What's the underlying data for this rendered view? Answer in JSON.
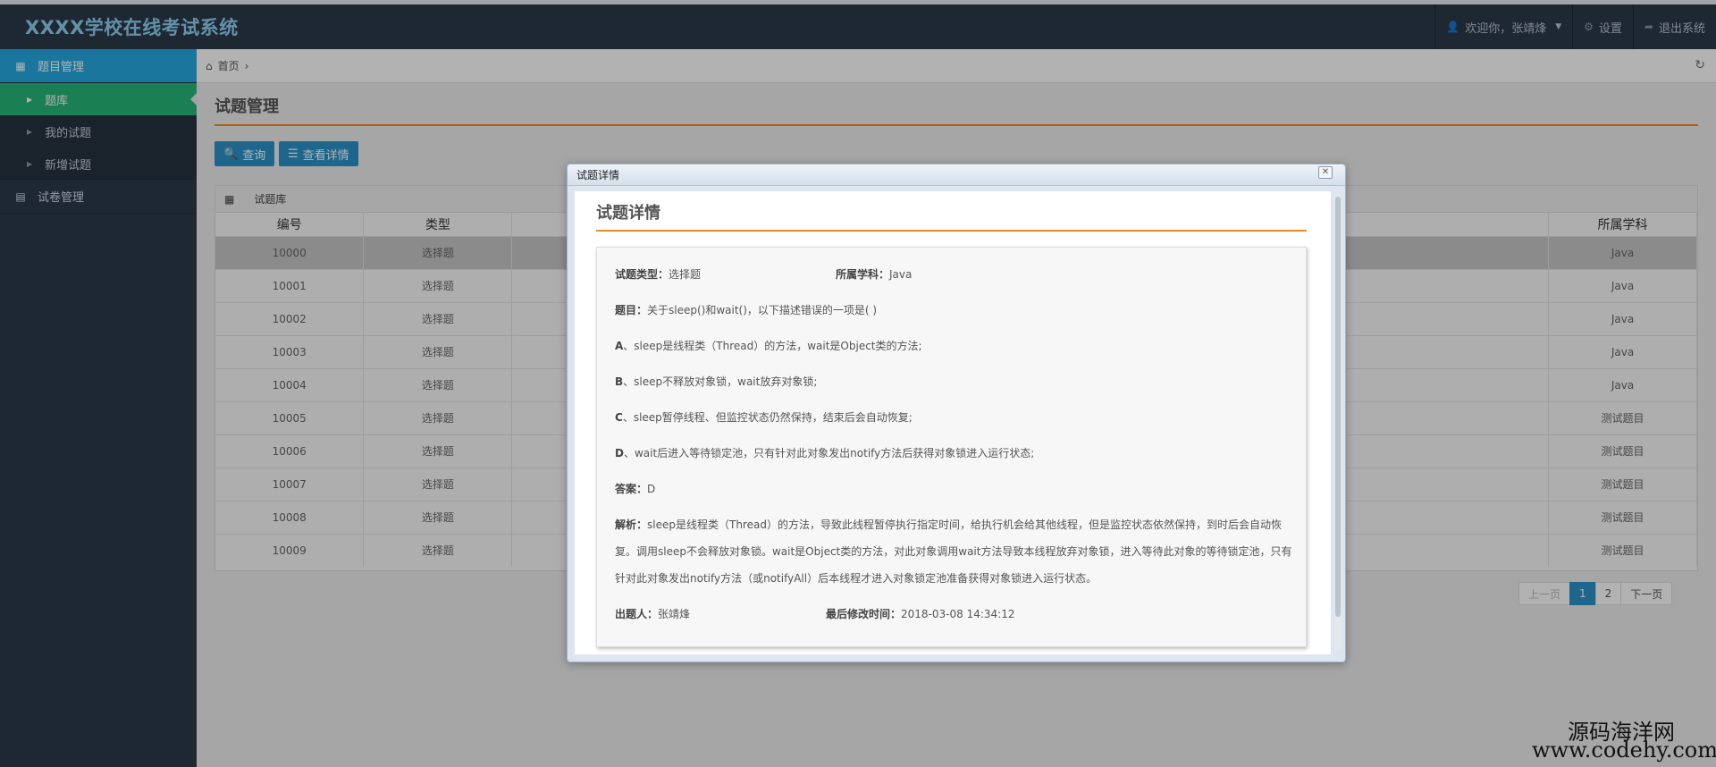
{
  "header": {
    "brand": "XXXX学校在线考试系统",
    "welcome": "欢迎你，张靖烽",
    "settings": "设置",
    "logout": "退出系统"
  },
  "sidebar": {
    "group1": "题目管理",
    "sub": [
      "题库",
      "我的试题",
      "新增试题"
    ],
    "group2": "试卷管理"
  },
  "breadcrumb": {
    "home": "首页"
  },
  "page": {
    "title": "试题管理",
    "query_btn": "查询",
    "detail_btn": "查看详情",
    "table_caption": "试题库"
  },
  "table": {
    "col_id": "编号",
    "col_type": "类型",
    "col_subject": "所属学科",
    "rows": [
      {
        "id": "10000",
        "type": "选择题",
        "subject": "Java"
      },
      {
        "id": "10001",
        "type": "选择题",
        "subject": "Java"
      },
      {
        "id": "10002",
        "type": "选择题",
        "subject": "Java"
      },
      {
        "id": "10003",
        "type": "选择题",
        "subject": "Java"
      },
      {
        "id": "10004",
        "type": "选择题",
        "subject": "Java"
      },
      {
        "id": "10005",
        "type": "选择题",
        "subject": "测试题目"
      },
      {
        "id": "10006",
        "type": "选择题",
        "subject": "测试题目"
      },
      {
        "id": "10007",
        "type": "选择题",
        "subject": "测试题目"
      },
      {
        "id": "10008",
        "type": "选择题",
        "subject": "测试题目"
      },
      {
        "id": "10009",
        "type": "选择题",
        "subject": "测试题目"
      }
    ]
  },
  "pager": {
    "prev": "上一页",
    "p1": "1",
    "p2": "2",
    "next": "下一页"
  },
  "modal": {
    "window_title": "试题详情",
    "heading": "试题详情",
    "type_label": "试题类型：",
    "type_value": "选择题",
    "subject_label": "所属学科：",
    "subject_value": "Java",
    "question_label": "题目：",
    "question_value": "关于sleep()和wait()，以下描述错误的一项是( )",
    "a_label": "A",
    "a_value": "、sleep是线程类（Thread）的方法，wait是Object类的方法;",
    "b_label": "B",
    "b_value": "、sleep不释放对象锁，wait放弃对象锁;",
    "c_label": "C",
    "c_value": "、sleep暂停线程、但监控状态仍然保持，结束后会自动恢复;",
    "d_label": "D",
    "d_value": "、wait后进入等待锁定池，只有针对此对象发出notify方法后获得对象锁进入运行状态;",
    "answer_label": "答案：",
    "answer_value": "D",
    "analysis_label": "解析：",
    "analysis_value": "sleep是线程类（Thread）的方法，导致此线程暂停执行指定时间，给执行机会给其他线程，但是监控状态依然保持，到时后会自动恢复。调用sleep不会释放对象锁。wait是Object类的方法，对此对象调用wait方法导致本线程放弃对象锁，进入等待此对象的等待锁定池，只有针对此对象发出notify方法（或notifyAll）后本线程才进入对象锁定池准备获得对象锁进入运行状态。",
    "author_label": "出题人：",
    "author_value": "张靖烽",
    "modified_label": "最后修改时间：",
    "modified_value": "2018-03-08 14:34:12"
  },
  "watermark": {
    "line1": "源码海洋网",
    "line2": "www.codehy.com"
  },
  "colors": {
    "accent_blue": "#27a9e3",
    "accent_green": "#28b779",
    "accent_orange": "#f08a24",
    "nav_bg": "#2b3a49"
  }
}
